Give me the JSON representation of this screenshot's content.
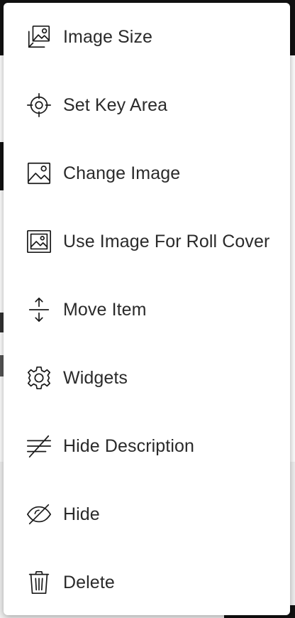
{
  "menu": {
    "items": [
      {
        "label": "Image Size",
        "icon": "image-size-icon"
      },
      {
        "label": "Set Key Area",
        "icon": "crosshair-icon"
      },
      {
        "label": "Change Image",
        "icon": "image-icon"
      },
      {
        "label": "Use Image For Roll Cover",
        "icon": "framed-image-icon"
      },
      {
        "label": "Move Item",
        "icon": "move-vertical-icon"
      },
      {
        "label": "Widgets",
        "icon": "gear-icon"
      },
      {
        "label": "Hide Description",
        "icon": "text-strikethrough-icon"
      },
      {
        "label": "Hide",
        "icon": "eye-off-icon"
      },
      {
        "label": "Delete",
        "icon": "trash-icon"
      }
    ]
  }
}
